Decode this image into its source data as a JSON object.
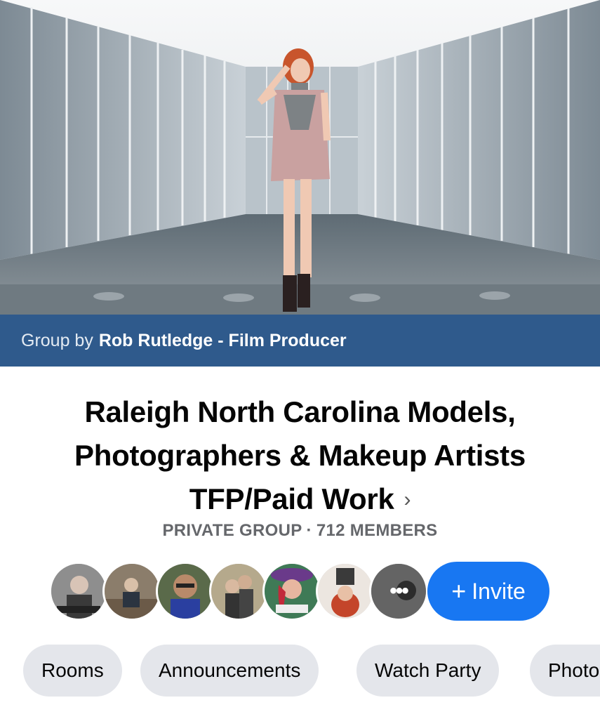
{
  "cover": {
    "banner_prefix": "Group by",
    "owner_name": "Rob Rutledge - Film Producer"
  },
  "group": {
    "title_line1": "Raleigh North Carolina Models,",
    "title_line2": "Photographers & Makeup Artists",
    "title_line3": "TFP/Paid Work",
    "chevron": "›",
    "privacy": "PRIVATE GROUP",
    "separator": "·",
    "members": "712 MEMBERS"
  },
  "members_row": {
    "avatars": [
      {
        "name": "member-avatar-1"
      },
      {
        "name": "member-avatar-2"
      },
      {
        "name": "member-avatar-3"
      },
      {
        "name": "member-avatar-4"
      },
      {
        "name": "member-avatar-5"
      },
      {
        "name": "member-avatar-6"
      },
      {
        "name": "member-avatar-more"
      }
    ],
    "more_indicator": "•••",
    "invite_plus": "+",
    "invite_label": "Invite"
  },
  "chips": [
    {
      "label": "Rooms"
    },
    {
      "label": "Announcements"
    },
    {
      "label": "Watch Party"
    },
    {
      "label": "Photos"
    }
  ],
  "colors": {
    "banner": "#2f5a8c",
    "invite": "#1877f2",
    "chip_bg": "#e4e6eb",
    "meta": "#65676b"
  }
}
